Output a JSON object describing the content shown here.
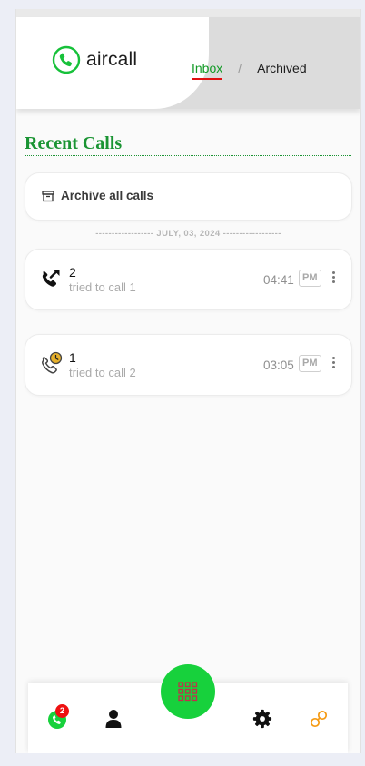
{
  "app": {
    "name": "aircall",
    "brand_color": "#17d13c",
    "accent_green": "#1a9433",
    "alert_red": "#ee1111"
  },
  "header": {
    "logo_text": "aircall",
    "logo_icon": "phone-circle-icon",
    "tabs": [
      {
        "label": "Inbox",
        "active": true
      },
      {
        "label": "Archived",
        "active": false
      }
    ],
    "separator": "/"
  },
  "main": {
    "title": "Recent Calls",
    "archive_button": {
      "label": "Archive all calls",
      "icon": "archive-box-icon"
    },
    "date_separator": "------------------ JULY, 03, 2024 ------------------",
    "calls": [
      {
        "number": "2",
        "subtitle": "tried to call 1",
        "time": "04:41",
        "ampm": "PM",
        "icon": "outgoing-call-icon"
      },
      {
        "number": "1",
        "subtitle": "tried to call 2",
        "time": "03:05",
        "ampm": "PM",
        "icon": "missed-call-clock-icon"
      }
    ]
  },
  "bottom_nav": {
    "calls_badge": "2",
    "items": [
      "calls-icon",
      "contacts-icon",
      "dialpad-icon",
      "settings-icon",
      "link-icon"
    ]
  }
}
